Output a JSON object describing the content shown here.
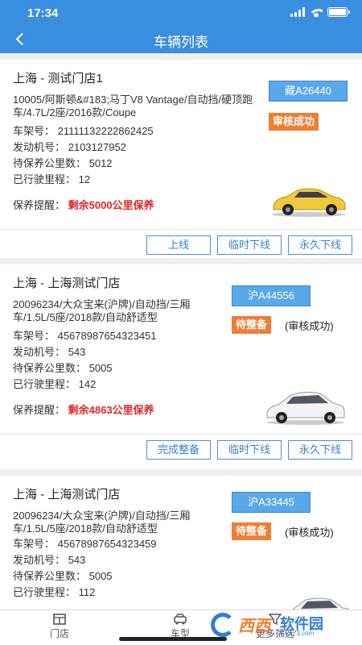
{
  "status_bar": {
    "time": "17:34"
  },
  "nav": {
    "title": "车辆列表"
  },
  "cards": [
    {
      "store": "上海 - 测试门店1",
      "description": "10005/阿斯顿&#183;马丁V8 Vantage/自动挡/硬顶跑车/4.7L/2座/2016款/Coupe",
      "plate": "藏A26440",
      "status": "审核成功",
      "status_note": "",
      "frame_no": "车架号：  21111132222862425",
      "engine_no": "发动机号：  2103127952",
      "maint_km": "待保养公里数：  5012",
      "driven_km": "已行驶里程：  12",
      "reminder_label": "保养提醒：",
      "reminder_value": "剩余5000公里保养",
      "car_color": "yellow",
      "buttons": [
        "上线",
        "临时下线",
        "永久下线"
      ]
    },
    {
      "store": "上海 - 上海测试门店",
      "description": "20096234/大众宝来(沪牌)/自动挡/三厢车/1.5L/5座/2018款/自动舒适型",
      "plate": "沪A44556",
      "status": "待整备",
      "status_note": "(审核成功)",
      "frame_no": "车架号：  45678987654323451",
      "engine_no": "发动机号：  543",
      "maint_km": "待保养公里数：  5005",
      "driven_km": "已行驶里程：  142",
      "reminder_label": "保养提醒：",
      "reminder_value": "剩余4863公里保养",
      "car_color": "white",
      "buttons": [
        "完成整备",
        "临时下线",
        "永久下线"
      ]
    },
    {
      "store": "上海 - 上海测试门店",
      "description": "20096234/大众宝来(沪牌)/自动挡/三厢车/1.5L/5座/2018款/自动舒适型",
      "plate": "沪A33445",
      "status": "待整备",
      "status_note": "(审核成功)",
      "frame_no": "车架号：  45678987654323459",
      "engine_no": "发动机号：  543",
      "maint_km": "待保养公里数：  5005",
      "driven_km": "已行驶里程：  112",
      "car_color": "white"
    }
  ],
  "tabs": [
    {
      "label": "门店",
      "icon": "store-icon"
    },
    {
      "label": "车型",
      "icon": "car-icon"
    },
    {
      "label": "更多筛选",
      "icon": "filter-icon"
    }
  ],
  "watermark": {
    "brand": "西西",
    "name": "软件园",
    "url": "CR173.com"
  },
  "colors": {
    "primary": "#3a8ee0",
    "status_orange": "#f07e32",
    "reminder_red": "#e0262a"
  }
}
